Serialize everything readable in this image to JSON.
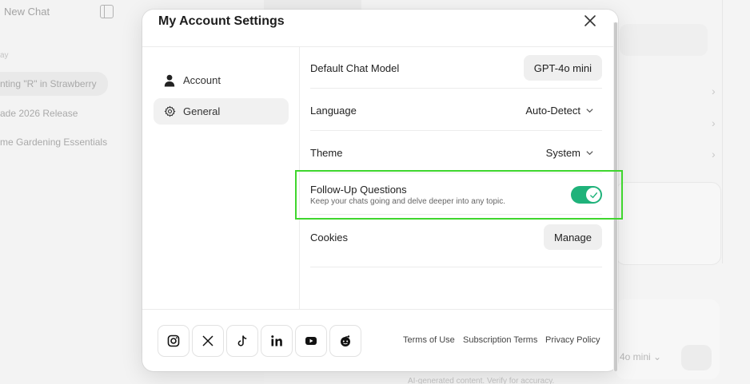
{
  "background": {
    "new_chat_label": "New Chat",
    "section_label": "ay",
    "chats": [
      {
        "title": "nting \"R\" in Strawberry"
      },
      {
        "title": "ade 2026 Release"
      },
      {
        "title": "me Gardening Essentials"
      }
    ],
    "model_label": "4o mini",
    "disclaimer": "AI-generated content. Verify for accuracy."
  },
  "modal": {
    "title": "My Account Settings",
    "nav": [
      {
        "label": "Account",
        "icon": "person-icon"
      },
      {
        "label": "General",
        "icon": "gear-icon"
      }
    ],
    "settings": {
      "default_model": {
        "label": "Default Chat Model",
        "value": "GPT-4o mini"
      },
      "language": {
        "label": "Language",
        "value": "Auto-Detect"
      },
      "theme": {
        "label": "Theme",
        "value": "System"
      },
      "follow_up": {
        "label": "Follow-Up Questions",
        "description": "Keep your chats going and delve deeper into any topic.",
        "enabled": true
      },
      "cookies": {
        "label": "Cookies",
        "button": "Manage"
      }
    },
    "social_icons": [
      "instagram-icon",
      "x-icon",
      "tiktok-icon",
      "linkedin-icon",
      "youtube-icon",
      "reddit-icon"
    ],
    "footer_links": [
      "Terms of Use",
      "Subscription Terms",
      "Privacy Policy"
    ]
  },
  "colors": {
    "accent_toggle": "#1fb27a",
    "highlight_box": "#3fd62e"
  }
}
